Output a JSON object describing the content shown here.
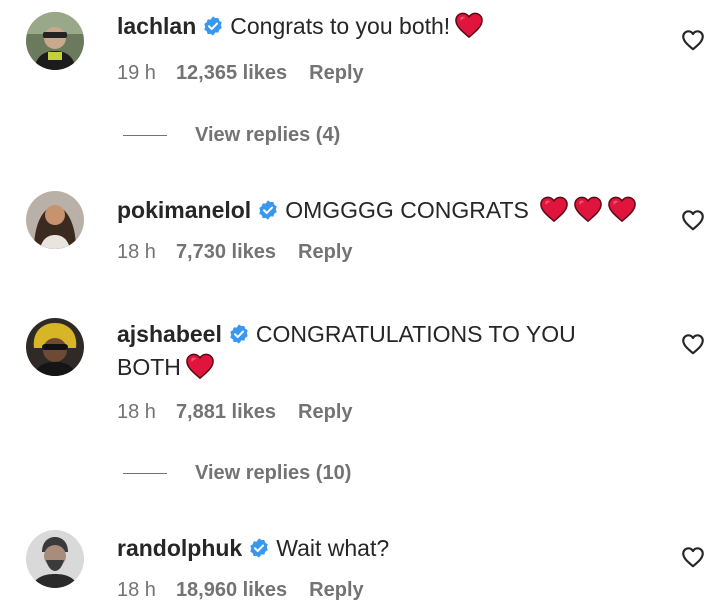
{
  "comments": [
    {
      "username": "lachlan",
      "text": "Congrats to you both!",
      "hearts": 1,
      "time": "19 h",
      "likes": "12,365 likes",
      "reply": "Reply",
      "view_replies": "View replies (4)"
    },
    {
      "username": "pokimanelol",
      "text": "OMGGGG CONGRATS",
      "hearts": 3,
      "time": "18 h",
      "likes": "7,730 likes",
      "reply": "Reply"
    },
    {
      "username": "ajshabeel",
      "text_line1": "CONGRATULATIONS TO YOU",
      "text_line2": "BOTH",
      "hearts": 1,
      "time": "18 h",
      "likes": "7,881 likes",
      "reply": "Reply",
      "view_replies": "View replies (10)"
    },
    {
      "username": "randolphuk",
      "text": "Wait what?",
      "hearts": 0,
      "time": "18 h",
      "likes": "18,960 likes",
      "reply": "Reply"
    }
  ],
  "icons": {
    "verified": "verified-badge-icon",
    "heart_emoji": "red-heart-emoji-icon",
    "like": "heart-outline-icon"
  },
  "colors": {
    "verified": "#3897f0",
    "heart": "#e0143c",
    "muted": "#737373",
    "text": "#262626"
  }
}
